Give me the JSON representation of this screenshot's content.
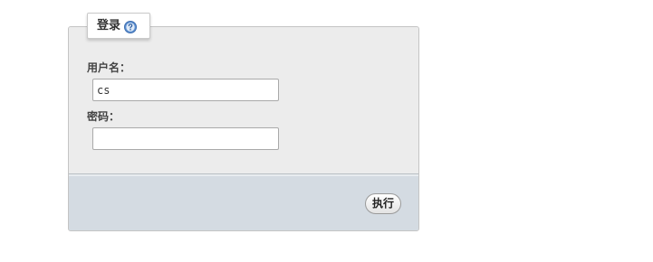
{
  "form": {
    "tab_title": "登录",
    "help_icon": "help-icon",
    "username_label": "用户名：",
    "username_value": "cs",
    "password_label": "密码：",
    "password_value": "",
    "submit_label": "执行"
  },
  "colors": {
    "panel_background": "#ececec",
    "footer_background": "#d4dbe2",
    "help_icon_blue": "#5b8fd0"
  }
}
